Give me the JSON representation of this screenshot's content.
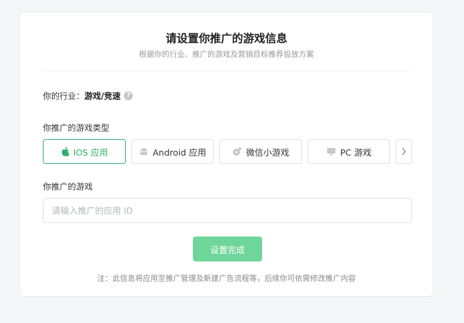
{
  "header": {
    "title": "请设置你推广的游戏信息",
    "subtitle": "根据你的行业、推广的游戏及营销目标推荐投放方案"
  },
  "industry": {
    "label": "你的行业：",
    "value": "游戏/竞速",
    "help_icon": "?"
  },
  "game_type": {
    "label": "你推广的游戏类型",
    "options": [
      {
        "label": "IOS 应用",
        "icon": "apple-icon",
        "selected": true
      },
      {
        "label": "Android 应用",
        "icon": "android-icon",
        "selected": false
      },
      {
        "label": "微信小游戏",
        "icon": "mini-game-icon",
        "selected": false
      },
      {
        "label": "PC 游戏",
        "icon": "monitor-icon",
        "selected": false
      }
    ],
    "next_icon": "chevron-right-icon"
  },
  "game": {
    "label": "你推广的游戏",
    "placeholder": "请输入推广的应用 ID",
    "value": ""
  },
  "submit_label": "设置完成",
  "note": "注：此信息将应用至推广管理及新建广告流程等，后续你可依需修改推广内容",
  "colors": {
    "accent": "#2fb069",
    "submit_bg": "#6fd69b",
    "border": "#dcdfe3"
  }
}
